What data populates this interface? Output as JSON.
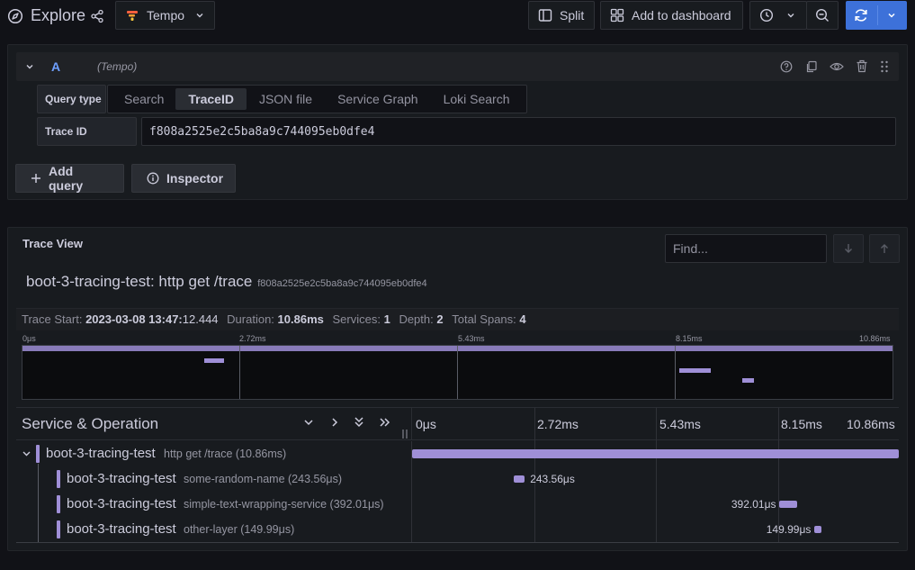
{
  "topbar": {
    "title": "Explore",
    "datasource": "Tempo",
    "split_label": "Split",
    "add_dashboard_label": "Add to dashboard"
  },
  "query": {
    "ref_id": "A",
    "datasource_hint": "(Tempo)",
    "query_type_label": "Query type",
    "query_types": [
      "Search",
      "TraceID",
      "JSON file",
      "Service Graph",
      "Loki Search"
    ],
    "selected_query_type": "TraceID",
    "trace_id_label": "Trace ID",
    "trace_id_value": "f808a2525e2c5ba8a9c744095eb0dfe4",
    "add_query_label": "Add query",
    "inspector_label": "Inspector"
  },
  "trace": {
    "panel_title": "Trace View",
    "find_placeholder": "Find...",
    "service": "boot-3-tracing-test",
    "operation": "http get /trace",
    "trace_id": "f808a2525e2c5ba8a9c744095eb0dfe4",
    "stats": {
      "start_label": "Trace Start:",
      "start_date": "2023-03-08 13:47:",
      "start_time": "12.444",
      "duration_label": "Duration:",
      "duration": "10.86ms",
      "services_label": "Services:",
      "services": "1",
      "depth_label": "Depth:",
      "depth": "2",
      "spans_label": "Total Spans:",
      "spans": "4"
    },
    "minimap_ticks": [
      "0μs",
      "2.72ms",
      "5.43ms",
      "8.15ms",
      "10.86ms"
    ],
    "column_header": "Service & Operation",
    "timeline_ticks": [
      "0μs",
      "2.72ms",
      "5.43ms",
      "8.15ms",
      "10.86ms"
    ],
    "total_duration_ms": 10.86,
    "spans_list": [
      {
        "service": "boot-3-tracing-test",
        "operation": "http get /trace (10.86ms)",
        "start_ms": 0,
        "duration_ms": 10.86,
        "duration_label": "",
        "depth": 0,
        "label_side": "none"
      },
      {
        "service": "boot-3-tracing-test",
        "operation": "some-random-name (243.56μs)",
        "start_ms": 2.27,
        "duration_ms": 0.24356,
        "duration_label": "243.56μs",
        "depth": 1,
        "label_side": "right"
      },
      {
        "service": "boot-3-tracing-test",
        "operation": "simple-text-wrapping-service (392.01μs)",
        "start_ms": 8.2,
        "duration_ms": 0.39201,
        "duration_label": "392.01μs",
        "depth": 1,
        "label_side": "left"
      },
      {
        "service": "boot-3-tracing-test",
        "operation": "other-layer (149.99μs)",
        "start_ms": 8.98,
        "duration_ms": 0.14999,
        "duration_label": "149.99μs",
        "depth": 1,
        "label_side": "left"
      }
    ]
  },
  "colors": {
    "accent": "#3d71d9",
    "span": "#9f8fd7",
    "ref_id": "#6e9fff",
    "background": "#111217",
    "panel": "#181b1f"
  }
}
